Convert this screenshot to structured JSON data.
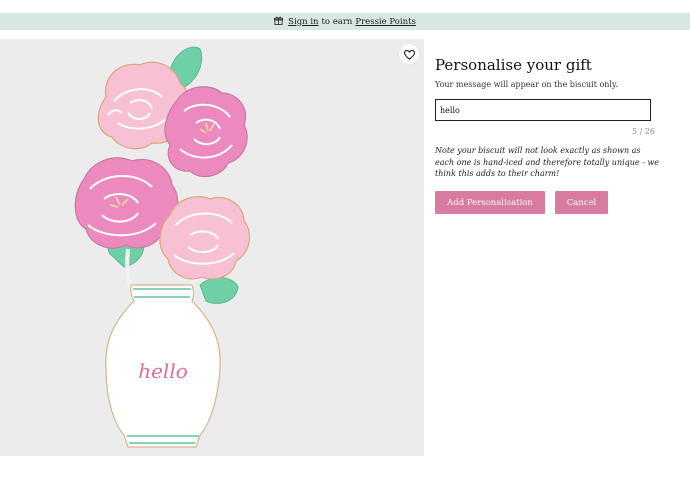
{
  "announcement": {
    "icon": "gift-icon",
    "sign_in": "Sign in",
    "middle": "to earn",
    "points": "Pressie Points"
  },
  "product_image": {
    "biscuit_text": "hello",
    "favorite_icon": "heart-outline-icon"
  },
  "personalise": {
    "title": "Personalise your gift",
    "subtitle": "Your message will appear on the biscuit only.",
    "message_value": "hello",
    "char_count": "5 / 26",
    "note": "Note your biscuit will not look exactly as shown as each one is hand-iced and therefore totally unique - we think this adds to their charm!",
    "add_label": "Add Personalisation",
    "cancel_label": "Cancel"
  },
  "colors": {
    "accent_pink": "#d97aa0",
    "announcement_bg": "#d7e7e4",
    "image_bg": "#ececec"
  }
}
